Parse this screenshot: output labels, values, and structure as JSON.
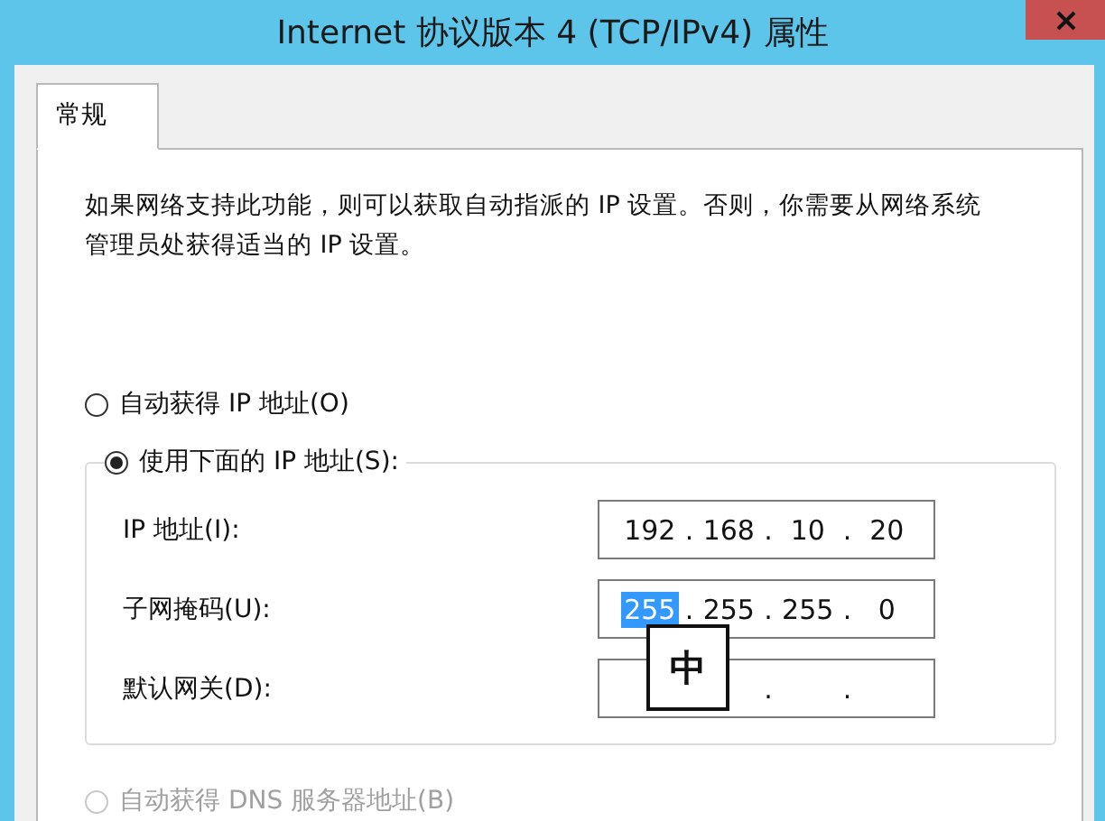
{
  "window": {
    "title": "Internet 协议版本 4 (TCP/IPv4) 属性"
  },
  "tabs": [
    {
      "label": "常规",
      "selected": true
    }
  ],
  "description": "如果网络支持此功能，则可以获取自动指派的 IP 设置。否则，你需要从网络系统管理员处获得适当的 IP 设置。",
  "ip_mode": [
    {
      "label": "自动获得 IP 地址(O)",
      "selected": false,
      "disabled": false
    },
    {
      "label": "使用下面的 IP 地址(S):",
      "selected": true,
      "disabled": false
    }
  ],
  "ip_fields": {
    "separator": ".",
    "rows": [
      {
        "label": "IP 地址(I):",
        "octets": [
          {
            "value": "192",
            "selected": false
          },
          {
            "value": "168",
            "selected": false
          },
          {
            "value": "10",
            "selected": false
          },
          {
            "value": "20",
            "selected": false
          }
        ]
      },
      {
        "label": "子网掩码(U):",
        "octets": [
          {
            "value": "255",
            "selected": true
          },
          {
            "value": "255",
            "selected": false
          },
          {
            "value": "255",
            "selected": false
          },
          {
            "value": "0",
            "selected": false
          }
        ]
      },
      {
        "label": "默认网关(D):"
      }
    ]
  },
  "ime_indicator": "中",
  "dns_mode": [
    {
      "label": "自动获得 DNS 服务器地址(B)",
      "selected": false,
      "disabled": true
    }
  ]
}
